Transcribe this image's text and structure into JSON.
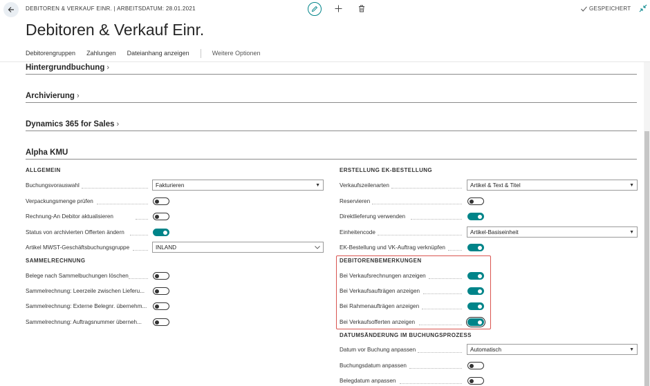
{
  "header": {
    "context_title": "DEBITOREN & VERKAUF EINR. | ARBEITSDATUM: 28.01.2021",
    "saved_label": "GESPEICHERT",
    "page_title": "Debitoren & Verkauf Einr."
  },
  "actions": {
    "items": [
      "Debitorengruppen",
      "Zahlungen",
      "Dateianhang anzeigen"
    ],
    "more": "Weitere Optionen"
  },
  "fasttabs": {
    "hintergrund": "Hintergrundbuchung",
    "archivierung": "Archivierung",
    "dynamics": "Dynamics 365 for Sales",
    "alpha": "Alpha KMU"
  },
  "left": {
    "allgemein_header": "ALLGEMEIN",
    "buchungsvorauswahl_label": "Buchungsvorauswahl",
    "buchungsvorauswahl_value": "Fakturieren",
    "verpackungsmenge_label": "Verpackungsmenge prüfen",
    "verpackungsmenge_on": false,
    "rechnung_an_label": "Rechnung-An Debitor aktualisieren",
    "rechnung_an_on": false,
    "status_archiv_label": "Status von archivierten Offerten ändern",
    "status_archiv_on": true,
    "mwst_label": "Artikel MWST-Geschäftsbuchungsgruppe",
    "mwst_value": "INLAND",
    "sammel_header": "SAMMELRECHNUNG",
    "belege_label": "Belege nach Sammelbuchungen löschen",
    "belege_on": false,
    "leerzeile_label": "Sammelrechnung: Leerzeile zwischen Lieferu...",
    "leerzeile_on": false,
    "externe_label": "Sammelrechnung: Externe Belegnr. übernehm...",
    "externe_on": false,
    "auftragsnummer_label": "Sammelrechnung: Auftragsnummer überneh...",
    "auftragsnummer_on": false
  },
  "right": {
    "ek_header": "ERSTELLUNG EK-BESTELLUNG",
    "verkaufszeilenarten_label": "Verkaufszeilenarten",
    "verkaufszeilenarten_value": "Artikel & Text & Titel",
    "reservieren_label": "Reservieren",
    "reservieren_on": false,
    "direktlieferung_label": "Direktlieferung verwenden",
    "direktlieferung_on": true,
    "einheitencode_label": "Einheitencode",
    "einheitencode_value": "Artikel-Basiseinheit",
    "ek_vk_label": "EK-Bestellung und VK-Auftrag verknüpfen",
    "ek_vk_on": true,
    "bemerkungen_header": "DEBITORENBEMERKUNGEN",
    "vk_rechnungen_label": "Bei Verkaufsrechnungen anzeigen",
    "vk_rechnungen_on": true,
    "vk_auftraegen_label": "Bei Verkaufsaufträgen anzeigen",
    "vk_auftraegen_on": true,
    "rahmen_label": "Bei Rahmenaufträgen anzeigen",
    "rahmen_on": true,
    "offerten_label": "Bei Verkaufsofferten anzeigen",
    "offerten_on": true,
    "datum_header": "DATUMSÄNDERUNG IM BUCHUNGSPROZESS",
    "datum_vor_label": "Datum vor Buchung anpassen",
    "datum_vor_value": "Automatisch",
    "buchungsdatum_label": "Buchungsdatum anpassen",
    "buchungsdatum_on": false,
    "belegdatum_label": "Belegdatum anpassen",
    "belegdatum_on": false
  },
  "colors": {
    "accent": "#008489",
    "highlight": "#d9534f"
  }
}
